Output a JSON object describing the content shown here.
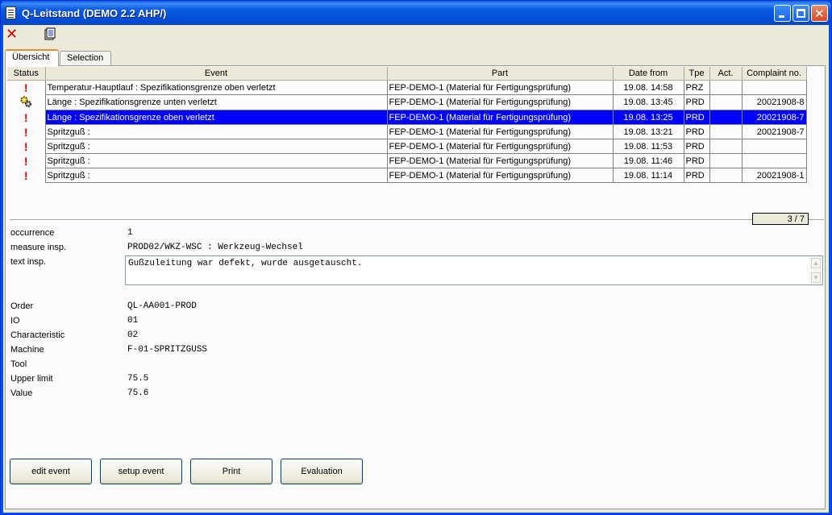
{
  "window": {
    "title": "Q-Leitstand (DEMO 2.2 AHP/)"
  },
  "toolbar": {
    "close_icon": "x-icon",
    "doc_icon": "document-icon"
  },
  "tabs": [
    {
      "label": "Übersicht",
      "active": true
    },
    {
      "label": "Selection",
      "active": false
    }
  ],
  "grid": {
    "headers": [
      "Status",
      "Event",
      "Part",
      "Date from",
      "Tpe",
      "Act.",
      "Complaint no."
    ],
    "rows": [
      {
        "status": "!",
        "event": "Temperatur-Hauptlauf : Spezifikationsgrenze oben verletzt",
        "part": "FEP-DEMO-1 (Material für Fertigungsprüfung)",
        "date": "19.08. 14:58",
        "tpe": "PRZ",
        "act": "",
        "complaint": ""
      },
      {
        "status": "gear",
        "event": "Länge : Spezifikationsgrenze unten verletzt",
        "part": "FEP-DEMO-1 (Material für Fertigungsprüfung)",
        "date": "19.08. 13:45",
        "tpe": "PRD",
        "act": "",
        "complaint": "20021908-8"
      },
      {
        "status": "!",
        "event": "Länge : Spezifikationsgrenze oben verletzt",
        "part": "FEP-DEMO-1 (Material für Fertigungsprüfung)",
        "date": "19.08. 13:25",
        "tpe": "PRD",
        "act": "",
        "complaint": "20021908-7",
        "selected": true
      },
      {
        "status": "!",
        "event": "Spritzguß :",
        "part": "FEP-DEMO-1 (Material für Fertigungsprüfung)",
        "date": "19.08. 13:21",
        "tpe": "PRD",
        "act": "",
        "complaint": "20021908-7"
      },
      {
        "status": "!",
        "event": "Spritzguß :",
        "part": "FEP-DEMO-1 (Material für Fertigungsprüfung)",
        "date": "19.08. 11:53",
        "tpe": "PRD",
        "act": "",
        "complaint": ""
      },
      {
        "status": "!",
        "event": "Spritzguß :",
        "part": "FEP-DEMO-1 (Material für Fertigungsprüfung)",
        "date": "19.08. 11:46",
        "tpe": "PRD",
        "act": "",
        "complaint": ""
      },
      {
        "status": "!",
        "event": "Spritzguß :",
        "part": "FEP-DEMO-1 (Material für Fertigungsprüfung)",
        "date": "19.08. 11:14",
        "tpe": "PRD",
        "act": "",
        "complaint": "20021908-1"
      }
    ]
  },
  "counter": "3 / 7",
  "details": {
    "occurrence_label": "occurrence",
    "occurrence": "1",
    "measure_label": "measure insp.",
    "measure": "PROD02/WKZ-WSC : Werkzeug-Wechsel",
    "text_label": "text insp.",
    "text": "Gußzuleitung war defekt, wurde ausgetauscht.",
    "order_label": "Order",
    "order": "QL-AA001-PROD",
    "io_label": "IO",
    "io": "01",
    "char_label": "Characteristic",
    "char": "02",
    "machine_label": "Machine",
    "machine": "F-01-SPRITZGUSS",
    "tool_label": "Tool",
    "tool": "",
    "upper_label": "Upper limit",
    "upper": "75.5",
    "value_label": "Value",
    "value": "75.6"
  },
  "buttons": {
    "edit": "edit event",
    "setup": "setup event",
    "print": "Print",
    "evaluation": "Evaluation"
  },
  "colors": {
    "selection": "#0000ff",
    "status_red": "#d40000",
    "title_blue": "#0054e3"
  }
}
